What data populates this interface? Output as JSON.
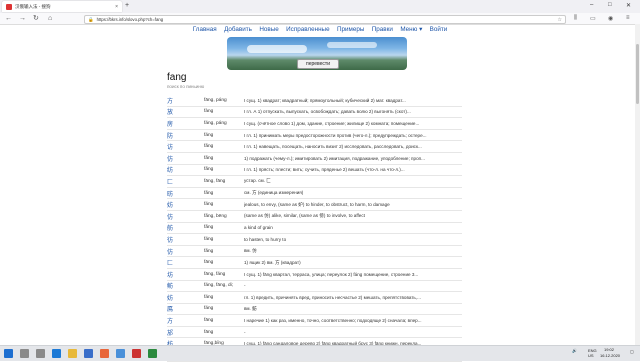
{
  "browser": {
    "tab_title": "汉俄输入法 - 搜狗",
    "tab_close": "×",
    "new_tab": "+",
    "url": "https://bkrs.info/slovo.php?ch=fang",
    "lock": "🔒",
    "win_min": "–",
    "win_max": "□",
    "win_close": "✕"
  },
  "site": {
    "nav": [
      "Главная",
      "Добавить",
      "Новые",
      "Исправленные",
      "Примеры",
      "Правки",
      "Меню ▾",
      "Войти"
    ],
    "translate_button": "перевести",
    "title": "fang",
    "subtitle": "поиск по пиньиню"
  },
  "rows": [
    {
      "hz": "方",
      "py": "fāng, páng",
      "def": "I сущ. 1) квадрат; квадратный; прямоугольный; кубический 2) мат. квадрат..."
    },
    {
      "hz": "放",
      "py": "fàng",
      "def": "I гл. А 1) отпускать, выпускать, освобождать; давать волю 2) выгонять (скот)..."
    },
    {
      "hz": "房",
      "py": "fáng, páng",
      "def": "I сущ. (счётное слово 1) дом, здание, строение; жилище 2) комната; помещение..."
    },
    {
      "hz": "防",
      "py": "fáng",
      "def": "I гл. 1) принимать меры предосторожности против (чего-л.); предупреждать; остере..."
    },
    {
      "hz": "访",
      "py": "fǎng",
      "def": "I гл. 1) навещать, посещать, наносить визит 2) исследовать, расследовать, доиск..."
    },
    {
      "hz": "仿",
      "py": "fǎng",
      "def": "1) подражать (чему-л.); имитировать 2) имитация, подражание, уподобление; проп..."
    },
    {
      "hz": "纺",
      "py": "fǎng",
      "def": "I гл. 1) прясть; плести; вить; сучить, пряденье 2) вешать (что-л. на что-л.)..."
    },
    {
      "hz": "匚",
      "py": "fāng, fāng",
      "def": "устар. см. 匚"
    },
    {
      "hz": "昉",
      "py": "fǎng",
      "def": "см. 方 (единица измерения)"
    },
    {
      "hz": "妨",
      "py": "fáng",
      "def": "jealous, to envy, (same as 妒) to hinder, to obstruct, to harm, to damage"
    },
    {
      "hz": "仿",
      "py": "fǎng, bēng",
      "def": "(same as 仿) alike, similar, (same as 傍) to involve, to affect"
    },
    {
      "hz": "舫",
      "py": "fǎng",
      "def": "a kind of grain"
    },
    {
      "hz": "彷",
      "py": "fáng",
      "def": "to hasten, to hurry to"
    },
    {
      "hz": "仿",
      "py": "fǎng",
      "def": "вм. 仿"
    },
    {
      "hz": "匚",
      "py": "fāng",
      "def": "1) ящик 2) вм. 方 (квадрат)"
    },
    {
      "hz": "坊",
      "py": "fāng, fáng",
      "def": "I сущ. 1) fāng квартал, терраса, улица; переулок 2) fáng помещение, строение 3..."
    },
    {
      "hz": "鲂",
      "py": "fáng, fāng, di;",
      "def": "-"
    },
    {
      "hz": "妨",
      "py": "fáng",
      "def": "гл. 1) вредить, причинять вред, приносить несчастье 2) мешать, препятствовать,..."
    },
    {
      "hz": "鳫",
      "py": "fáng",
      "def": "вм. 鲂"
    },
    {
      "hz": "方",
      "py": "fāng",
      "def": "I наречие 1) как раз, именно, точно, соответственно; подходяще 2) сначала; впер..."
    },
    {
      "hz": "邡",
      "py": "fāng",
      "def": "-"
    },
    {
      "hz": "枋",
      "py": "fāng,bǐng",
      "def": "I сущ. 1) fāng сандаловое дерево 2) fāng квадратный брус 3) fāng книжн. перекла..."
    },
    {
      "hz": "汸",
      "py": "fāng",
      "def": "собств. миф. (сокр. вм. 汸水 汸水) Фанщуй (река)"
    }
  ],
  "taskbar": {
    "lang": "ENG\nUS",
    "time": "19:02",
    "date": "16.12.2020"
  }
}
